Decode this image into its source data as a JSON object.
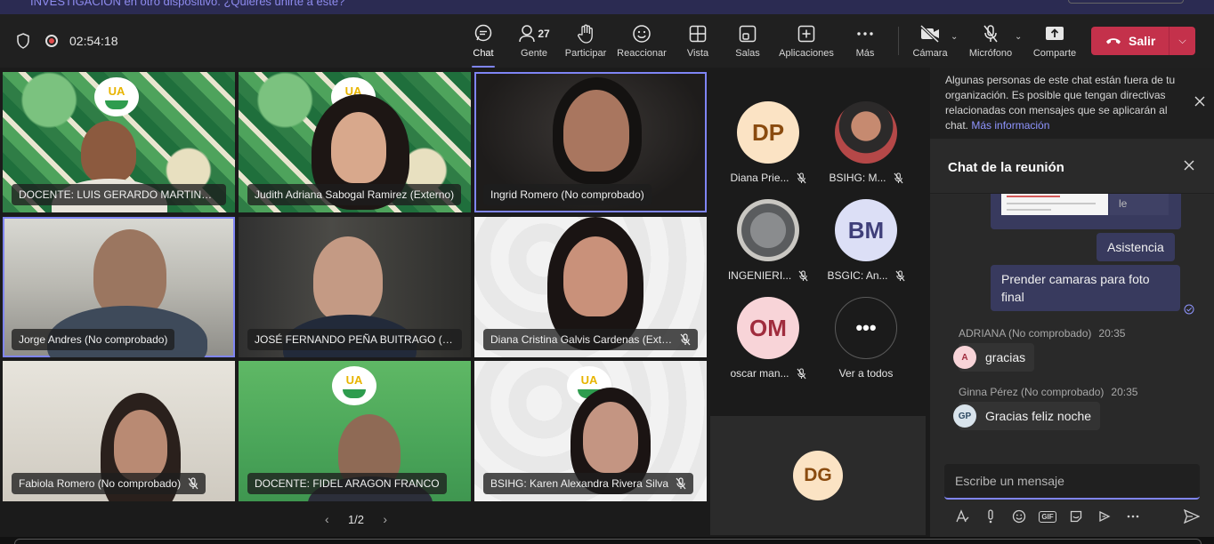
{
  "notice": {
    "text": "INVESTIGACIÓN en otro dispositivo. ¿Quieres unirte a este?"
  },
  "toolbar": {
    "timer": "02:54:18",
    "buttons": [
      {
        "label": "Chat",
        "icon": "chat-icon"
      },
      {
        "label": "Gente",
        "icon": "people-icon",
        "count": "27"
      },
      {
        "label": "Participar",
        "icon": "raise-hand-icon"
      },
      {
        "label": "Reaccionar",
        "icon": "smiley-icon"
      },
      {
        "label": "Vista",
        "icon": "grid-view-icon"
      },
      {
        "label": "Salas",
        "icon": "rooms-icon"
      },
      {
        "label": "Aplicaciones",
        "icon": "apps-plus-icon"
      },
      {
        "label": "Más",
        "icon": "more-icon"
      },
      {
        "label": "Cámara",
        "icon": "camera-off-icon"
      },
      {
        "label": "Micrófono",
        "icon": "mic-off-icon"
      },
      {
        "label": "Comparte",
        "icon": "share-icon"
      }
    ],
    "leave_label": "Salir"
  },
  "tiles": [
    {
      "name": "DOCENTE: LUIS GERARDO MARTINEZ MARTINEZ",
      "muted": false
    },
    {
      "name": "Judith Adriana Sabogal Ramirez (Externo)",
      "muted": false
    },
    {
      "name": "Ingrid Romero (No comprobado)",
      "muted": false
    },
    {
      "name": "Jorge Andres (No comprobado)",
      "muted": false
    },
    {
      "name": "JOSÉ FERNANDO PEÑA BUITRAGO (Externo)",
      "muted": false
    },
    {
      "name": "Diana Cristina Galvis Cardenas (Externo)",
      "muted": true
    },
    {
      "name": "Fabiola Romero (No comprobado)",
      "muted": true
    },
    {
      "name": "DOCENTE: FIDEL ARAGON FRANCO",
      "muted": false
    },
    {
      "name": "BSIHG: Karen Alexandra Rivera Silva",
      "muted": true
    }
  ],
  "logo_text": "UA",
  "pager": {
    "label": "1/2"
  },
  "roster": [
    {
      "initials": "DP",
      "name": "Diana Prie...",
      "muted": true
    },
    {
      "initials": "",
      "name": "BSIHG: M...",
      "muted": true
    },
    {
      "initials": "",
      "name": "INGENIERI...",
      "muted": true
    },
    {
      "initials": "BM",
      "name": "BSGIC: An...",
      "muted": true
    },
    {
      "initials": "OM",
      "name": "oscar man...",
      "muted": true
    },
    {
      "initials": "",
      "name": "Ver a todos",
      "muted": false
    }
  ],
  "dg_tile": {
    "initials": "DG"
  },
  "chat": {
    "external_notice": "Algunas personas de este chat están fuera de tu organización. Es posible que tengan directivas relacionadas con mensajes que se aplicarán al chat.",
    "external_link": "Más información",
    "title": "Chat de la reunión",
    "partial_text": "le",
    "messages_self": [
      "Asistencia",
      "Prender camaras para foto final"
    ],
    "messages_other": [
      {
        "author": "ADRIANA (No comprobado)",
        "time": "20:35",
        "initials": "A",
        "text": "gracias"
      },
      {
        "author": "Ginna Pérez (No comprobado)",
        "time": "20:35",
        "initials": "GP",
        "text": "Gracias feliz noche"
      }
    ],
    "compose_placeholder": "Escribe un mensaje",
    "tools": [
      "format-icon",
      "priority-icon",
      "emoji-icon",
      "gif-icon",
      "sticker-icon",
      "loop-icon",
      "more-options-icon",
      "send-icon"
    ]
  }
}
